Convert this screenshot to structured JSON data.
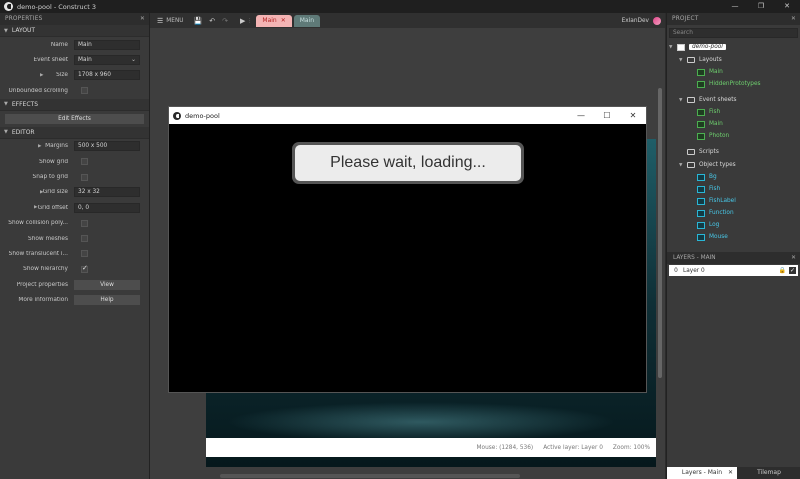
{
  "window": {
    "title": "demo-pool - Construct 3",
    "controls": [
      "—",
      "❐",
      "✕"
    ]
  },
  "properties": {
    "header": "PROPERTIES",
    "layout_section": "LAYOUT",
    "name_label": "Name",
    "name_value": "Main",
    "event_sheet_label": "Event sheet",
    "event_sheet_value": "Main",
    "size_label": "Size",
    "size_value": "1708 x 960",
    "unbounded_label": "Unbounded scrolling",
    "effects_section": "EFFECTS",
    "edit_effects": "Edit Effects",
    "editor_section": "EDITOR",
    "margins_label": "Margins",
    "margins_value": "500 x 500",
    "show_grid_label": "Show grid",
    "snap_grid_label": "Snap to grid",
    "grid_size_label": "Grid size",
    "grid_size_value": "32 x 32",
    "grid_offset_label": "Grid offset",
    "grid_offset_value": "0, 0",
    "show_collision_label": "Show collision poly...",
    "show_meshes_label": "Show meshes",
    "show_translucent_label": "Show translucent i...",
    "show_hierarchy_label": "Show hierarchy",
    "project_props_label": "Project properties",
    "project_props_btn": "View",
    "more_info_label": "More information",
    "more_info_btn": "Help"
  },
  "toolbar": {
    "menu_label": "MENU",
    "tabs": [
      {
        "label": "Main",
        "active": true
      },
      {
        "label": "Main",
        "active": false
      }
    ],
    "user": "ExlanDev"
  },
  "status": {
    "mouse": "Mouse: (1284, 536)",
    "active_layer": "Active layer: Layer 0",
    "zoom": "Zoom: 100%"
  },
  "preview": {
    "title": "demo-pool",
    "controls": [
      "—",
      "☐",
      "✕"
    ],
    "loading_text": "Please wait, loading..."
  },
  "project": {
    "header": "PROJECT",
    "search_placeholder": "Search",
    "root": "demo-pool",
    "layouts_folder": "Layouts",
    "layouts": [
      "Main",
      "HiddenPrototypes"
    ],
    "event_sheets_folder": "Event sheets",
    "event_sheets": [
      "Fish",
      "Main",
      "Photon"
    ],
    "scripts_folder": "Scripts",
    "object_types_folder": "Object types",
    "object_types": [
      "Bg",
      "Fish",
      "FishLabel",
      "Function",
      "Log",
      "Mouse"
    ]
  },
  "layers": {
    "header": "LAYERS - MAIN",
    "rows": [
      {
        "num": "0",
        "name": "Layer 0"
      }
    ],
    "tabs": [
      "Layers - Main",
      "Tilemap"
    ]
  },
  "colors": {
    "active_tab": "#f4b4b4",
    "green_item": "#6ecf6e",
    "cyan_item": "#48c8e8"
  }
}
